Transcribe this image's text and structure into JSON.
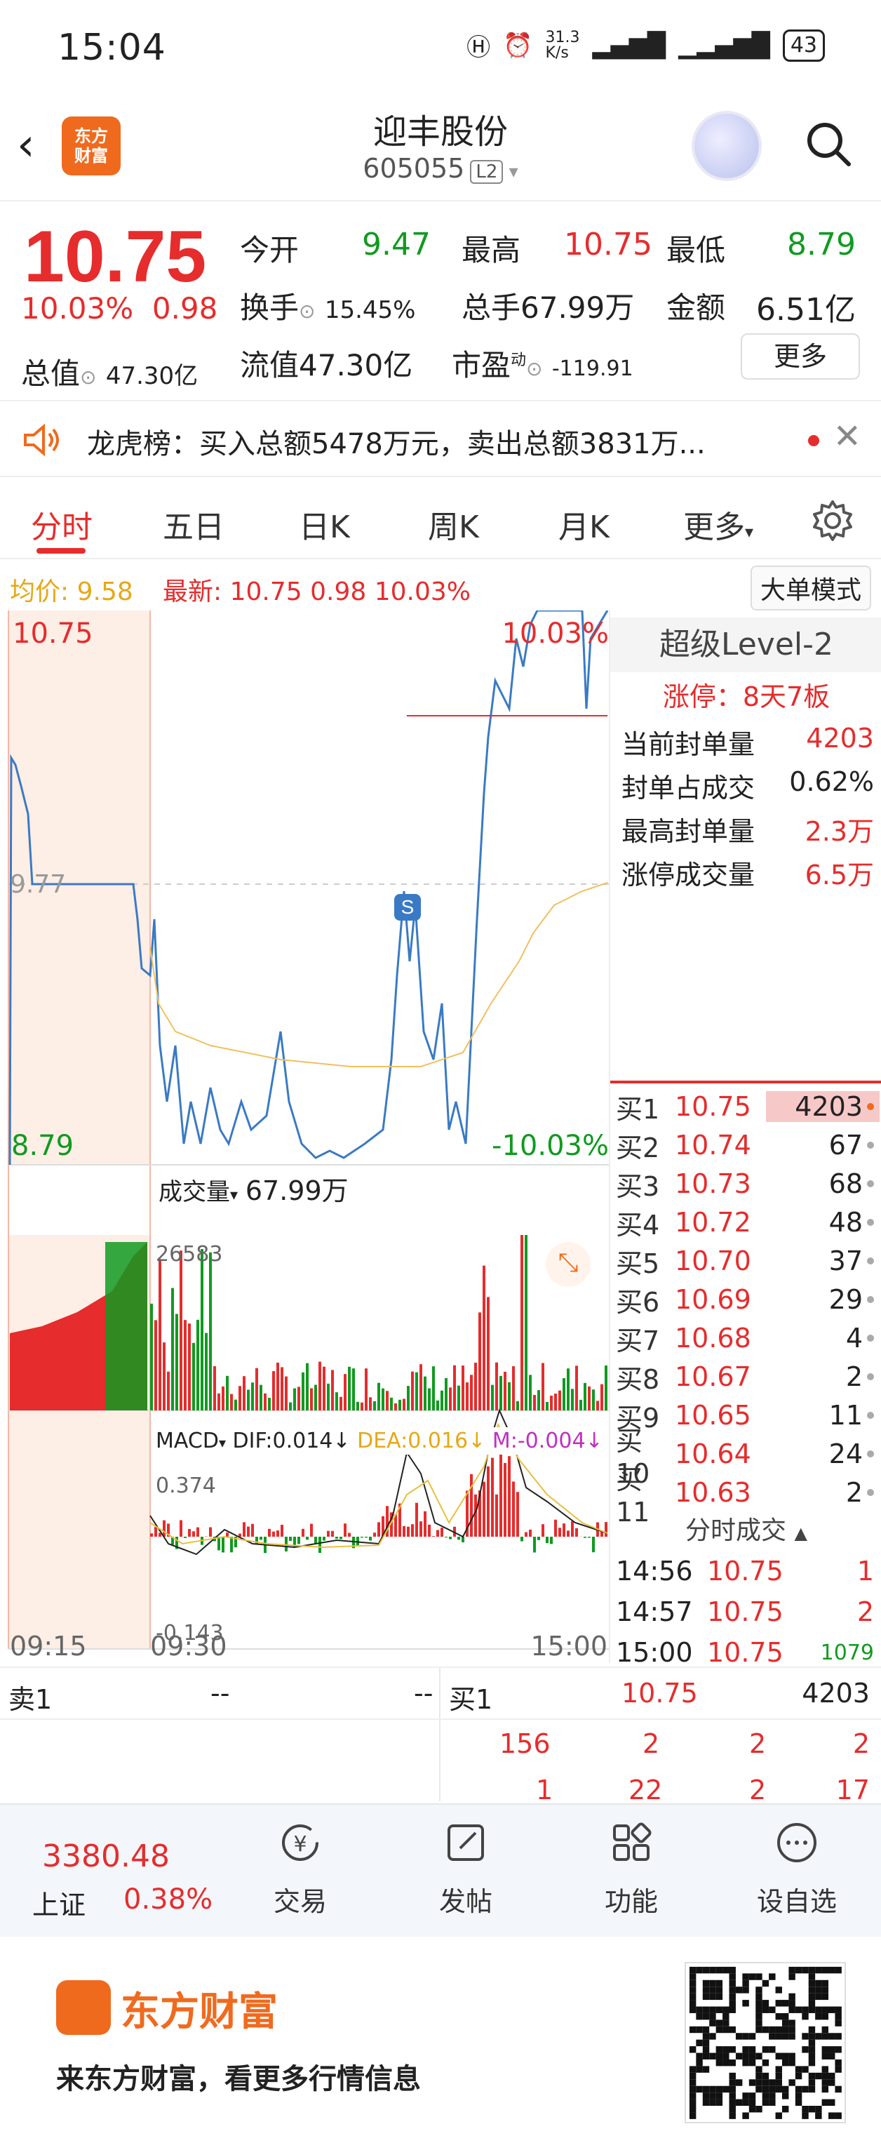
{
  "status_bar": {
    "time": "15:04",
    "net_speed": "31.3\nK/s",
    "battery": "43"
  },
  "header": {
    "stock_name": "迎丰股份",
    "stock_code": "605055",
    "level_badge": "L2",
    "logo_text": "东方\n财富"
  },
  "quote": {
    "price": "10.75",
    "change_pct": "10.03%",
    "change": "0.98",
    "open_label": "今开",
    "open": "9.47",
    "high_label": "最高",
    "high": "10.75",
    "low_label": "最低",
    "low": "8.79",
    "turnover_label": "换手",
    "turnover": "15.45%",
    "volume_label": "总手",
    "volume": "67.99万",
    "amount_label": "金额",
    "amount": "6.51亿",
    "mktcap_label": "总值",
    "mktcap": "47.30亿",
    "float_label": "流值",
    "float_cap": "47.30亿",
    "pe_label": "市盈",
    "pe_sup": "动",
    "pe": "-119.91",
    "more_label": "更多"
  },
  "dragon": {
    "text": "龙虎榜：买入总额5478万元，卖出总额3831万..."
  },
  "tabs": [
    "分时",
    "五日",
    "日K",
    "周K",
    "月K",
    "更多"
  ],
  "avg_line": {
    "avg_label": "均价:",
    "avg_value": "9.58",
    "latest_label": "最新:",
    "latest_value": "10.75 0.98 10.03%",
    "mode_button": "大单模式"
  },
  "chart": {
    "price_high": "10.75",
    "price_mid": "9.77",
    "price_low": "8.79",
    "pct_high": "10.03%",
    "pct_low": "-10.03%",
    "volume_label": "成交量",
    "volume_value": "67.99万",
    "volume_max": "26583",
    "macd_label": "MACD",
    "dif": "DIF:0.014↓",
    "dea": "DEA:0.016↓",
    "m": "M:-0.004↓",
    "macd_max": "0.374",
    "macd_min": "-0.143",
    "time_start": "09:15",
    "time_open": "09:30",
    "time_end": "15:00",
    "marker": "S"
  },
  "right_panel": {
    "title": "超级Level-2",
    "limit_up": "涨停：8天7板",
    "seal": [
      {
        "label": "当前封单量",
        "value": "4203"
      },
      {
        "label": "封单占成交",
        "value": "0.62%"
      },
      {
        "label": "最高封单量",
        "value": "2.3万"
      },
      {
        "label": "涨停成交量",
        "value": "6.5万"
      }
    ],
    "bids": [
      {
        "label": "买1",
        "price": "10.75",
        "vol": "4203"
      },
      {
        "label": "买2",
        "price": "10.74",
        "vol": "67"
      },
      {
        "label": "买3",
        "price": "10.73",
        "vol": "68"
      },
      {
        "label": "买4",
        "price": "10.72",
        "vol": "48"
      },
      {
        "label": "买5",
        "price": "10.70",
        "vol": "37"
      },
      {
        "label": "买6",
        "price": "10.69",
        "vol": "29"
      },
      {
        "label": "买7",
        "price": "10.68",
        "vol": "4"
      },
      {
        "label": "买8",
        "price": "10.67",
        "vol": "2"
      },
      {
        "label": "买9",
        "price": "10.65",
        "vol": "11"
      },
      {
        "label": "买10",
        "price": "10.64",
        "vol": "24"
      },
      {
        "label": "买11",
        "price": "10.63",
        "vol": "2"
      }
    ],
    "trades_title": "分时成交",
    "trades": [
      {
        "time": "14:56",
        "price": "10.75",
        "vol": "1"
      },
      {
        "time": "14:57",
        "price": "10.75",
        "vol": "2"
      },
      {
        "time": "15:00",
        "price": "10.75",
        "vol": "1079"
      }
    ]
  },
  "order_strip": {
    "sell1_label": "卖1",
    "sell1_price": "--",
    "sell1_vol": "--",
    "buy1_label": "买1",
    "buy1_price": "10.75",
    "buy1_vol": "4203",
    "row1": [
      "156",
      "2",
      "2",
      "2"
    ],
    "row2": [
      "1",
      "22",
      "2",
      "17"
    ]
  },
  "bottom_nav": {
    "index_value": "3380.48",
    "index_name": "上证",
    "index_pct": "0.38%",
    "items": [
      "交易",
      "发帖",
      "功能",
      "设自选"
    ]
  },
  "footer": {
    "brand": "东方财富",
    "slogan": "来东方财富，看更多行情信息"
  }
}
